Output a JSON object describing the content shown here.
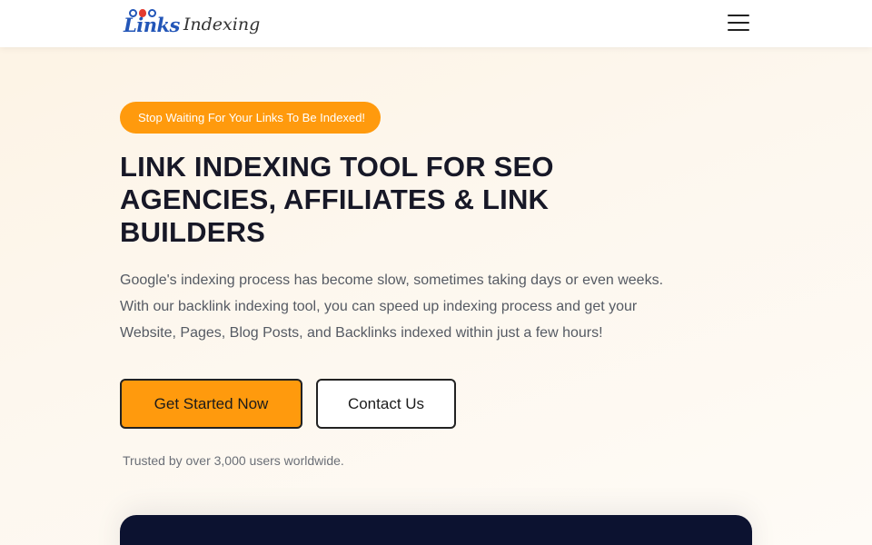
{
  "header": {
    "logo_mark": "Links",
    "logo_text": "Indexing",
    "menu_icon": "hamburger-menu-icon"
  },
  "hero": {
    "badge_icon": "megaphone-icon",
    "badge_icon_glyph": "",
    "badge_text": "Stop Waiting For Your Links To Be Indexed!",
    "title": "LINK INDEXING TOOL FOR SEO AGENCIES, AFFILIATES & LINK BUILDERS",
    "description": "Google's indexing process has become slow, sometimes taking days or even weeks. With our backlink indexing tool, you can speed up indexing process and get your Website, Pages, Blog Posts, and Backlinks indexed within just a few hours!",
    "primary_button": "Get Started Now",
    "secondary_button": "Contact Us",
    "trust_icon": "shield-check-icon",
    "trust_icon_glyph": "",
    "trust_text": "Trusted by over 3,000 users worldwide."
  },
  "colors": {
    "accent": "#ff9a0d",
    "panel": "#0c1230",
    "heading": "#171827",
    "body_text": "#555a63"
  }
}
